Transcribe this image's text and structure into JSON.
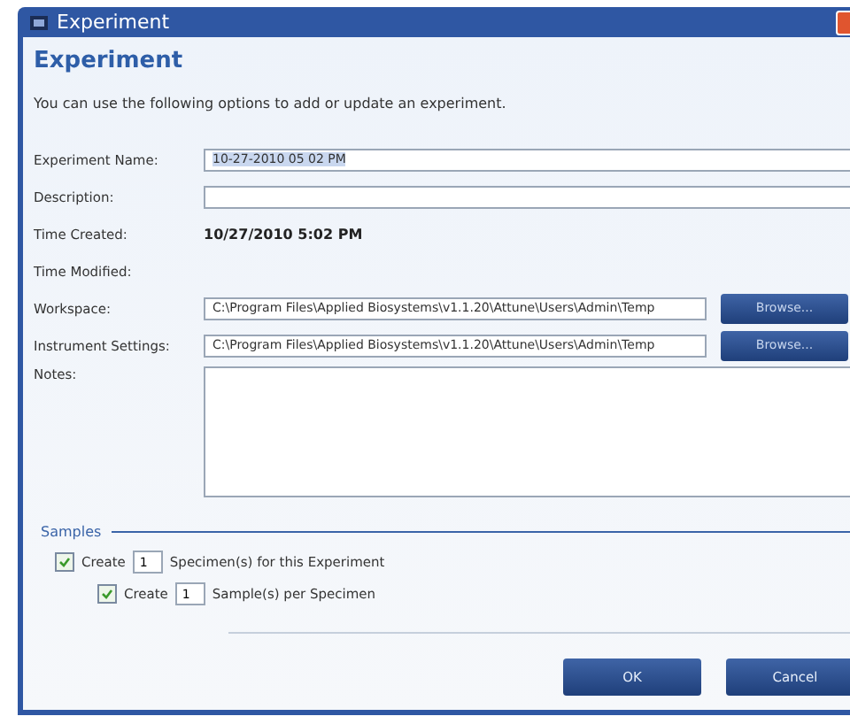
{
  "window": {
    "title": "Experiment"
  },
  "heading": "Experiment",
  "intro": "You can use the following options to add or update an experiment.",
  "fields": [
    {
      "kind": "input",
      "label": "Experiment Name:",
      "value": "10-27-2010 05 02 PM",
      "selected": true
    },
    {
      "kind": "input",
      "label": "Description:"
    },
    {
      "kind": "text",
      "label": "Time Created:",
      "value": "10/27/2010 5:02 PM"
    },
    {
      "kind": "text",
      "label": "Time Modified:"
    },
    {
      "kind": "browse",
      "label": "Workspace:",
      "value": "C:\\Program Files\\Applied Biosystems\\v1.1.20\\Attune\\Users\\Admin\\Temp",
      "button": "Browse..."
    },
    {
      "kind": "browse",
      "label": "Instrument Settings:",
      "value": "C:\\Program Files\\Applied Biosystems\\v1.1.20\\Attune\\Users\\Admin\\Temp",
      "button": "Browse..."
    },
    {
      "kind": "area",
      "label": "Notes:"
    }
  ],
  "samples": {
    "title": "Samples",
    "rows": [
      {
        "checked": true,
        "before": "Create",
        "count": "1",
        "after": "Specimen(s) for this Experiment"
      },
      {
        "checked": true,
        "before": "Create",
        "count": "1",
        "after": "Sample(s) per Specimen"
      }
    ]
  },
  "buttons": [
    "OK",
    "Cancel"
  ]
}
